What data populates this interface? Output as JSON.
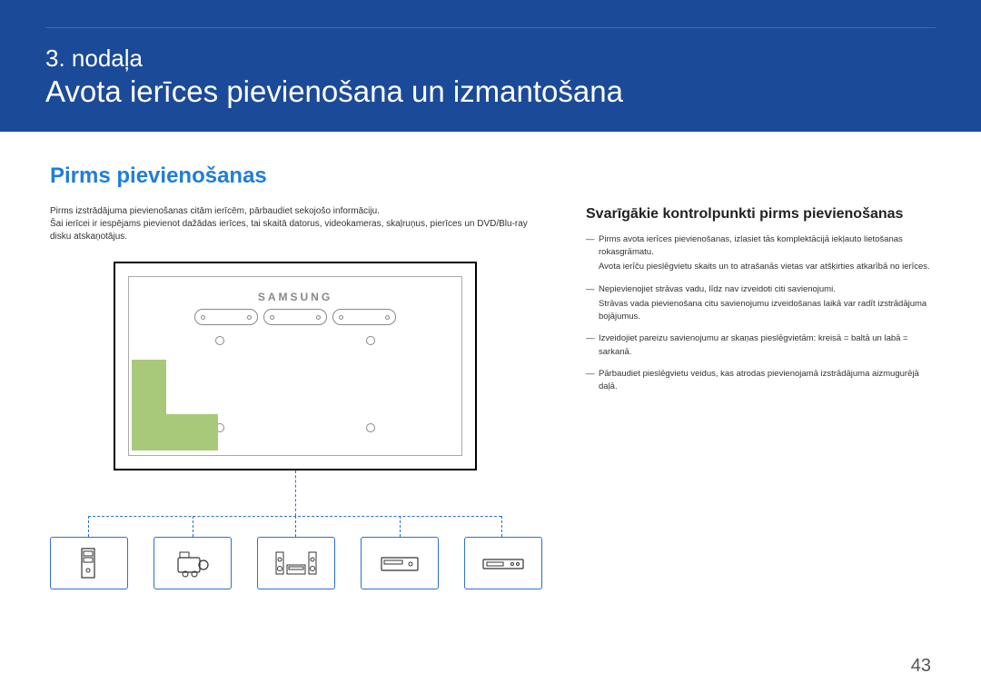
{
  "header": {
    "chapter_num": "3. nodaļa",
    "chapter_title": "Avota ierīces pievienošana un izmantošana"
  },
  "section": {
    "title": "Pirms pievienošanas",
    "intro_line1": "Pirms izstrādājuma pievienošanas citām ierīcēm, pārbaudiet sekojošo informāciju.",
    "intro_line2": "Šai ierīcei ir iespējams pievienot dažādas ierīces, tai skaitā datorus, videokameras, skaļruņus, pierīces un DVD/Blu-ray disku atskaņotājus."
  },
  "diagram": {
    "brand": "SAMSUNG"
  },
  "right": {
    "subheading": "Svarīgākie kontrolpunkti pirms pievienošanas",
    "items": [
      {
        "main": "Pirms avota ierīces pievienošanas, izlasiet tās komplektācijā iekļauto lietošanas rokasgrāmatu.",
        "sub": "Avota ierīču pieslēgvietu skaits un to atrašanās vietas var atšķirties atkarībā no ierīces."
      },
      {
        "main": "Nepievienojiet strāvas vadu, līdz nav izveidoti citi savienojumi.",
        "sub": "Strāvas vada pievienošana citu savienojumu izveidošanas laikā var radīt izstrādājuma bojājumus."
      },
      {
        "main": "Izveidojiet pareizu savienojumu ar skaņas pieslēgvietām: kreisā = baltā un labā = sarkanā.",
        "sub": ""
      },
      {
        "main": "Pārbaudiet pieslēgvietu veidus, kas atrodas pievienojamā izstrādājuma aizmugurējā daļā.",
        "sub": ""
      }
    ]
  },
  "page_number": "43"
}
